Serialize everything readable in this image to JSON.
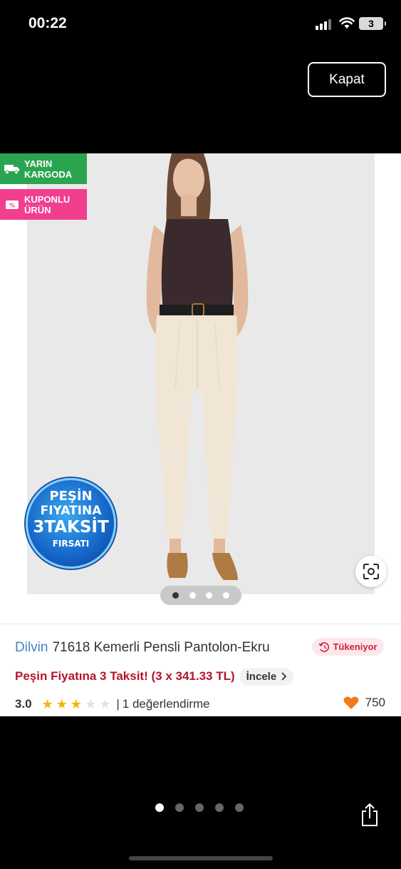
{
  "status_bar": {
    "time": "00:22",
    "battery": "3"
  },
  "close_label": "Kapat",
  "badges": {
    "cargo": {
      "line1": "YARIN",
      "line2": "KARGODA",
      "color": "#2ba44f"
    },
    "coupon": {
      "line1": "KUPONLU",
      "line2": "ÜRÜN",
      "color": "#f23e8e"
    }
  },
  "promo_seal": {
    "line1": "PEŞİN",
    "line2": "FIYATINA",
    "line3": "3TAKSİT",
    "line4": "FIRSATI"
  },
  "image_pager": {
    "count": 4,
    "active": 0
  },
  "product": {
    "brand": "Dilvin",
    "title": "71618 Kemerli Pensli Pantolon-Ekru",
    "stock_status": "Tükeniyor",
    "installment_text": "Peşin Fiyatına 3 Taksit! (3 x 341.33 TL)",
    "review_button": "İncele",
    "rating": "3.0",
    "rating_stars": 3,
    "max_stars": 5,
    "separator": "|",
    "review_count": "1 değerlendirme",
    "favorites": "750"
  },
  "gallery_pager": {
    "count": 5,
    "active": 0
  },
  "colors": {
    "brand_blue": "#4a83c4",
    "installment_red": "#b5152b",
    "stock_red": "#d21f3c",
    "star": "#f5b400",
    "heart": "#f27a1a"
  }
}
